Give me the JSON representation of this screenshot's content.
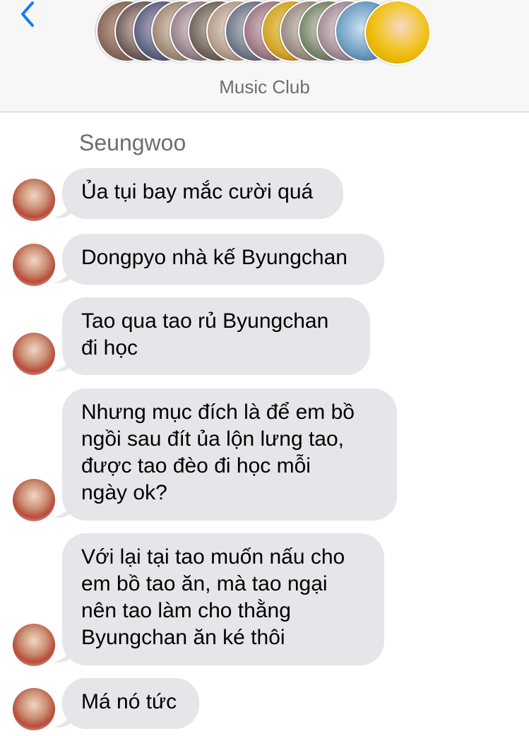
{
  "header": {
    "group_name": "Music Club",
    "back_icon": "chevron-left-icon",
    "accent": "#147efb"
  },
  "conversation": {
    "sender": "Seungwoo",
    "bubble_color": "#e5e5ea",
    "messages": [
      {
        "text": "Ủa tụi bay mắc cười quá"
      },
      {
        "text": "Dongpyo nhà kế Byungchan"
      },
      {
        "text": "Tao qua tao rủ Byungchan\nđi học"
      },
      {
        "text": "Nhưng mục đích là để em bồ\nngồi sau đít ủa lộn lưng tao,\nđược tao đèo đi học mỗi\nngày ok?"
      },
      {
        "text": "Với lại tại tao muốn nấu cho\nem bồ tao ăn, mà tao ngại\nnên tao làm cho thằng\nByungchan ăn ké thôi"
      },
      {
        "text": "Má nó tức"
      }
    ]
  }
}
